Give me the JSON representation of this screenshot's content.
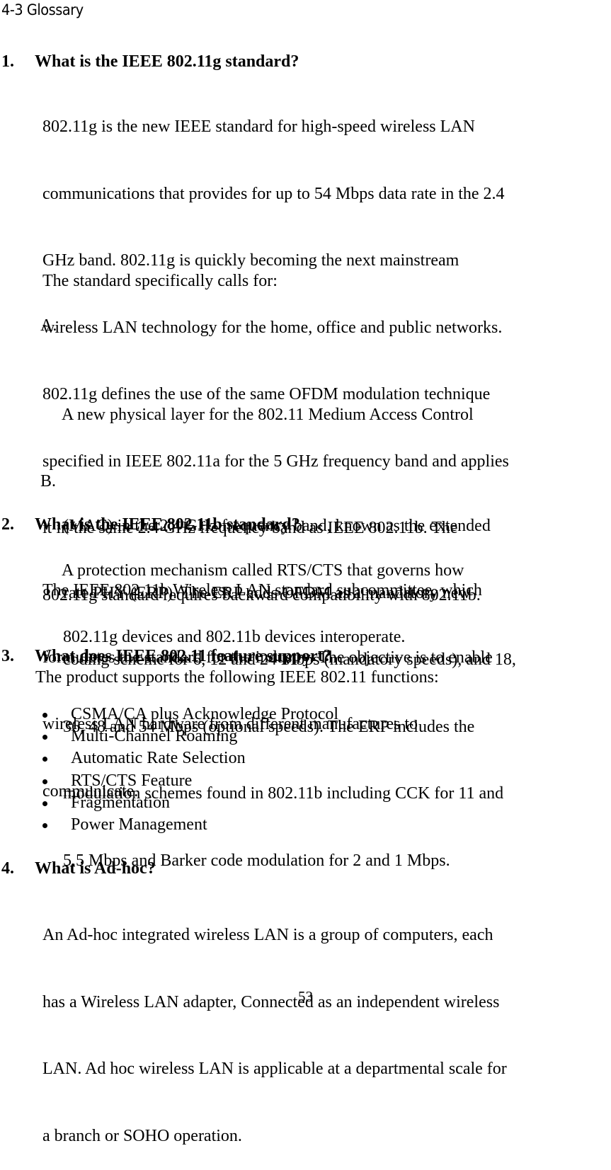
{
  "section_title": "4-3 Glossary",
  "q1": {
    "number": "1.",
    "question": "What is the IEEE 802.11g standard?",
    "lines": [
      "802.11g is the new IEEE standard for high-speed wireless LAN",
      "communications that provides for up to 54 Mbps data rate in the 2.4",
      "GHz band. 802.11g is quickly becoming the next mainstream",
      "wireless LAN technology for the home, office and public networks.",
      "802.11g defines the use of the same OFDM modulation technique",
      "specified in IEEE 802.11a for the 5 GHz frequency band and applies",
      "it in the same 2.4 GHz frequency band as IEEE 802.11b. The",
      "802.11g standard requires backward compatibility with 802.11b."
    ],
    "calls_for": "The standard specifically calls for:",
    "items": [
      {
        "marker": "A.",
        "lines": [
          "A new physical layer for the 802.11 Medium Access Control",
          "(MAC) in the 2.4 GHz frequency band, known as the extended",
          "rate PHY (ERP). The ERP adds OFDM as a mandatory new",
          "coding scheme for 6, 12 and 24 Mbps (mandatory speeds), and 18,",
          "36, 48 and 54 Mbps (optional speeds). The ERP includes the",
          "modulation schemes found in 802.11b including CCK for 11 and",
          "5.5 Mbps and Barker code modulation for 2 and 1 Mbps."
        ]
      },
      {
        "marker": "B.",
        "lines": [
          "A protection mechanism called RTS/CTS that governs how",
          "802.11g devices and 802.11b devices interoperate."
        ]
      }
    ]
  },
  "q2": {
    "number": "2.",
    "question": "What is the IEEE 802.11b standard?",
    "lines": [
      "The IEEE 802.11b Wireless LAN standard subcommittee, which",
      "formulates the standard for the industry. The objective is to enable",
      "wireless LAN hardware from different manufactures to",
      "communicate."
    ]
  },
  "q3": {
    "number": "3.",
    "question": "What does IEEE 802.11 feature support?",
    "intro": "The product supports the following IEEE 802.11 functions:",
    "bullets": [
      "CSMA/CA plus Acknowledge Protocol",
      "Multi-Channel Roaming",
      "Automatic Rate Selection",
      "RTS/CTS Feature",
      "Fragmentation",
      "Power Management"
    ]
  },
  "q4": {
    "number": "4.",
    "question": "What is Ad-hoc?",
    "lines": [
      "An Ad-hoc integrated wireless LAN is a group of computers, each",
      "has a Wireless LAN adapter, Connected as an independent wireless",
      "LAN. Ad hoc wireless LAN is applicable at a departmental scale for",
      "a branch or SOHO operation."
    ]
  },
  "page_number": "53"
}
